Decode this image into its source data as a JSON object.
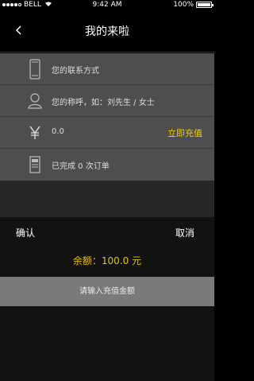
{
  "status_bar": {
    "carrier": "BELL",
    "time": "9:42 AM",
    "battery": "100%",
    "battery_level": 1.0
  },
  "header": {
    "title": "我的来啦"
  },
  "list": {
    "contact_placeholder": "您的联系方式",
    "name_placeholder": "您的称呼，如：刘先生 / 女士",
    "balance_value": "0.0",
    "recharge_link": "立即充值",
    "orders_text": "已完成 0 次订单"
  },
  "sheet": {
    "confirm_label": "确认",
    "cancel_label": "取消",
    "balance_text": "余额：100.0 元",
    "amount_placeholder": "请输入充值金额"
  },
  "colors": {
    "accent": "#e6c200",
    "list_bg": "#4e4e4e"
  },
  "icons": [
    "signal-dots-icon",
    "wifi-icon",
    "back-chevron-icon",
    "phone-icon",
    "person-icon",
    "yen-icon",
    "order-icon"
  ]
}
